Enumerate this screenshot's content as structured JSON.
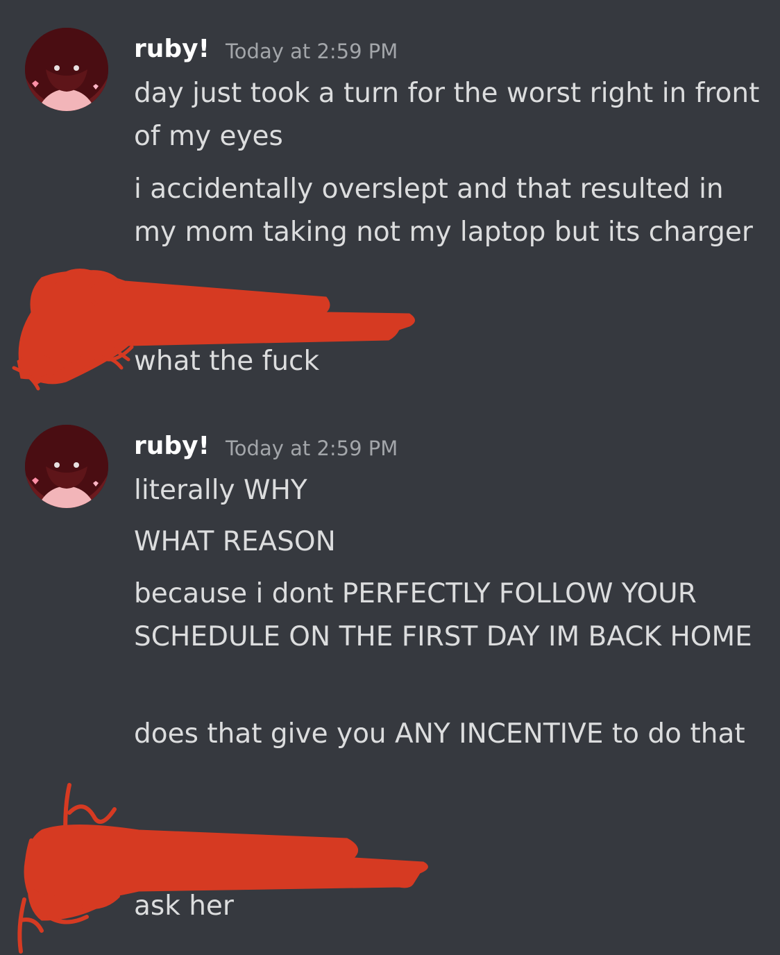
{
  "colors": {
    "background": "#36393f",
    "username": "#ffffff",
    "timestamp": "#a3a6aa",
    "message_text": "#dcddde",
    "redaction": "#d63a22",
    "avatar_bg": "#4a0d12"
  },
  "conversation": [
    {
      "author": "ruby!",
      "timestamp": "Today at 2:59 PM",
      "avatar_icon": "ruby-avatar",
      "messages": [
        "day just took a turn for the worst right in front of my eyes",
        "i accidentally overslept and that resulted in my mom taking not my laptop but its charger"
      ]
    },
    {
      "author_redacted": true,
      "messages": [
        "what the fuck"
      ]
    },
    {
      "author": "ruby!",
      "timestamp": "Today at 2:59 PM",
      "avatar_icon": "ruby-avatar",
      "messages": [
        "literally WHY",
        "WHAT REASON",
        "because i dont PERFECTLY FOLLOW YOUR SCHEDULE ON THE FIRST DAY IM BACK HOME",
        "does that give you ANY INCENTIVE to do that"
      ]
    },
    {
      "author_redacted": true,
      "messages": [
        "ask her"
      ]
    }
  ]
}
